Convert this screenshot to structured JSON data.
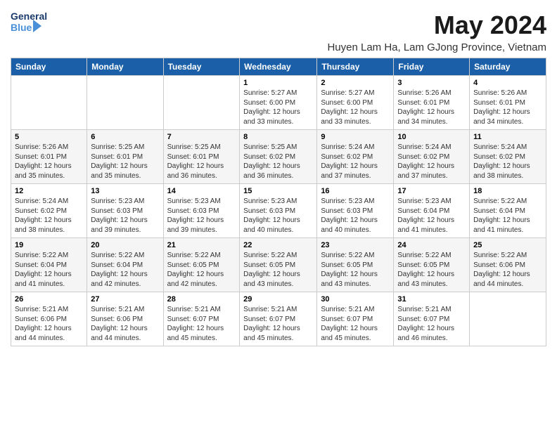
{
  "logo": {
    "general": "General",
    "blue": "Blue"
  },
  "title": {
    "month_year": "May 2024",
    "location": "Huyen Lam Ha, Lam GJong Province, Vietnam"
  },
  "weekdays": [
    "Sunday",
    "Monday",
    "Tuesday",
    "Wednesday",
    "Thursday",
    "Friday",
    "Saturday"
  ],
  "weeks": [
    [
      {
        "day": "",
        "info": ""
      },
      {
        "day": "",
        "info": ""
      },
      {
        "day": "",
        "info": ""
      },
      {
        "day": "1",
        "info": "Sunrise: 5:27 AM\nSunset: 6:00 PM\nDaylight: 12 hours\nand 33 minutes."
      },
      {
        "day": "2",
        "info": "Sunrise: 5:27 AM\nSunset: 6:00 PM\nDaylight: 12 hours\nand 33 minutes."
      },
      {
        "day": "3",
        "info": "Sunrise: 5:26 AM\nSunset: 6:01 PM\nDaylight: 12 hours\nand 34 minutes."
      },
      {
        "day": "4",
        "info": "Sunrise: 5:26 AM\nSunset: 6:01 PM\nDaylight: 12 hours\nand 34 minutes."
      }
    ],
    [
      {
        "day": "5",
        "info": "Sunrise: 5:26 AM\nSunset: 6:01 PM\nDaylight: 12 hours\nand 35 minutes."
      },
      {
        "day": "6",
        "info": "Sunrise: 5:25 AM\nSunset: 6:01 PM\nDaylight: 12 hours\nand 35 minutes."
      },
      {
        "day": "7",
        "info": "Sunrise: 5:25 AM\nSunset: 6:01 PM\nDaylight: 12 hours\nand 36 minutes."
      },
      {
        "day": "8",
        "info": "Sunrise: 5:25 AM\nSunset: 6:02 PM\nDaylight: 12 hours\nand 36 minutes."
      },
      {
        "day": "9",
        "info": "Sunrise: 5:24 AM\nSunset: 6:02 PM\nDaylight: 12 hours\nand 37 minutes."
      },
      {
        "day": "10",
        "info": "Sunrise: 5:24 AM\nSunset: 6:02 PM\nDaylight: 12 hours\nand 37 minutes."
      },
      {
        "day": "11",
        "info": "Sunrise: 5:24 AM\nSunset: 6:02 PM\nDaylight: 12 hours\nand 38 minutes."
      }
    ],
    [
      {
        "day": "12",
        "info": "Sunrise: 5:24 AM\nSunset: 6:02 PM\nDaylight: 12 hours\nand 38 minutes."
      },
      {
        "day": "13",
        "info": "Sunrise: 5:23 AM\nSunset: 6:03 PM\nDaylight: 12 hours\nand 39 minutes."
      },
      {
        "day": "14",
        "info": "Sunrise: 5:23 AM\nSunset: 6:03 PM\nDaylight: 12 hours\nand 39 minutes."
      },
      {
        "day": "15",
        "info": "Sunrise: 5:23 AM\nSunset: 6:03 PM\nDaylight: 12 hours\nand 40 minutes."
      },
      {
        "day": "16",
        "info": "Sunrise: 5:23 AM\nSunset: 6:03 PM\nDaylight: 12 hours\nand 40 minutes."
      },
      {
        "day": "17",
        "info": "Sunrise: 5:23 AM\nSunset: 6:04 PM\nDaylight: 12 hours\nand 41 minutes."
      },
      {
        "day": "18",
        "info": "Sunrise: 5:22 AM\nSunset: 6:04 PM\nDaylight: 12 hours\nand 41 minutes."
      }
    ],
    [
      {
        "day": "19",
        "info": "Sunrise: 5:22 AM\nSunset: 6:04 PM\nDaylight: 12 hours\nand 41 minutes."
      },
      {
        "day": "20",
        "info": "Sunrise: 5:22 AM\nSunset: 6:04 PM\nDaylight: 12 hours\nand 42 minutes."
      },
      {
        "day": "21",
        "info": "Sunrise: 5:22 AM\nSunset: 6:05 PM\nDaylight: 12 hours\nand 42 minutes."
      },
      {
        "day": "22",
        "info": "Sunrise: 5:22 AM\nSunset: 6:05 PM\nDaylight: 12 hours\nand 43 minutes."
      },
      {
        "day": "23",
        "info": "Sunrise: 5:22 AM\nSunset: 6:05 PM\nDaylight: 12 hours\nand 43 minutes."
      },
      {
        "day": "24",
        "info": "Sunrise: 5:22 AM\nSunset: 6:05 PM\nDaylight: 12 hours\nand 43 minutes."
      },
      {
        "day": "25",
        "info": "Sunrise: 5:22 AM\nSunset: 6:06 PM\nDaylight: 12 hours\nand 44 minutes."
      }
    ],
    [
      {
        "day": "26",
        "info": "Sunrise: 5:21 AM\nSunset: 6:06 PM\nDaylight: 12 hours\nand 44 minutes."
      },
      {
        "day": "27",
        "info": "Sunrise: 5:21 AM\nSunset: 6:06 PM\nDaylight: 12 hours\nand 44 minutes."
      },
      {
        "day": "28",
        "info": "Sunrise: 5:21 AM\nSunset: 6:07 PM\nDaylight: 12 hours\nand 45 minutes."
      },
      {
        "day": "29",
        "info": "Sunrise: 5:21 AM\nSunset: 6:07 PM\nDaylight: 12 hours\nand 45 minutes."
      },
      {
        "day": "30",
        "info": "Sunrise: 5:21 AM\nSunset: 6:07 PM\nDaylight: 12 hours\nand 45 minutes."
      },
      {
        "day": "31",
        "info": "Sunrise: 5:21 AM\nSunset: 6:07 PM\nDaylight: 12 hours\nand 46 minutes."
      },
      {
        "day": "",
        "info": ""
      }
    ]
  ]
}
